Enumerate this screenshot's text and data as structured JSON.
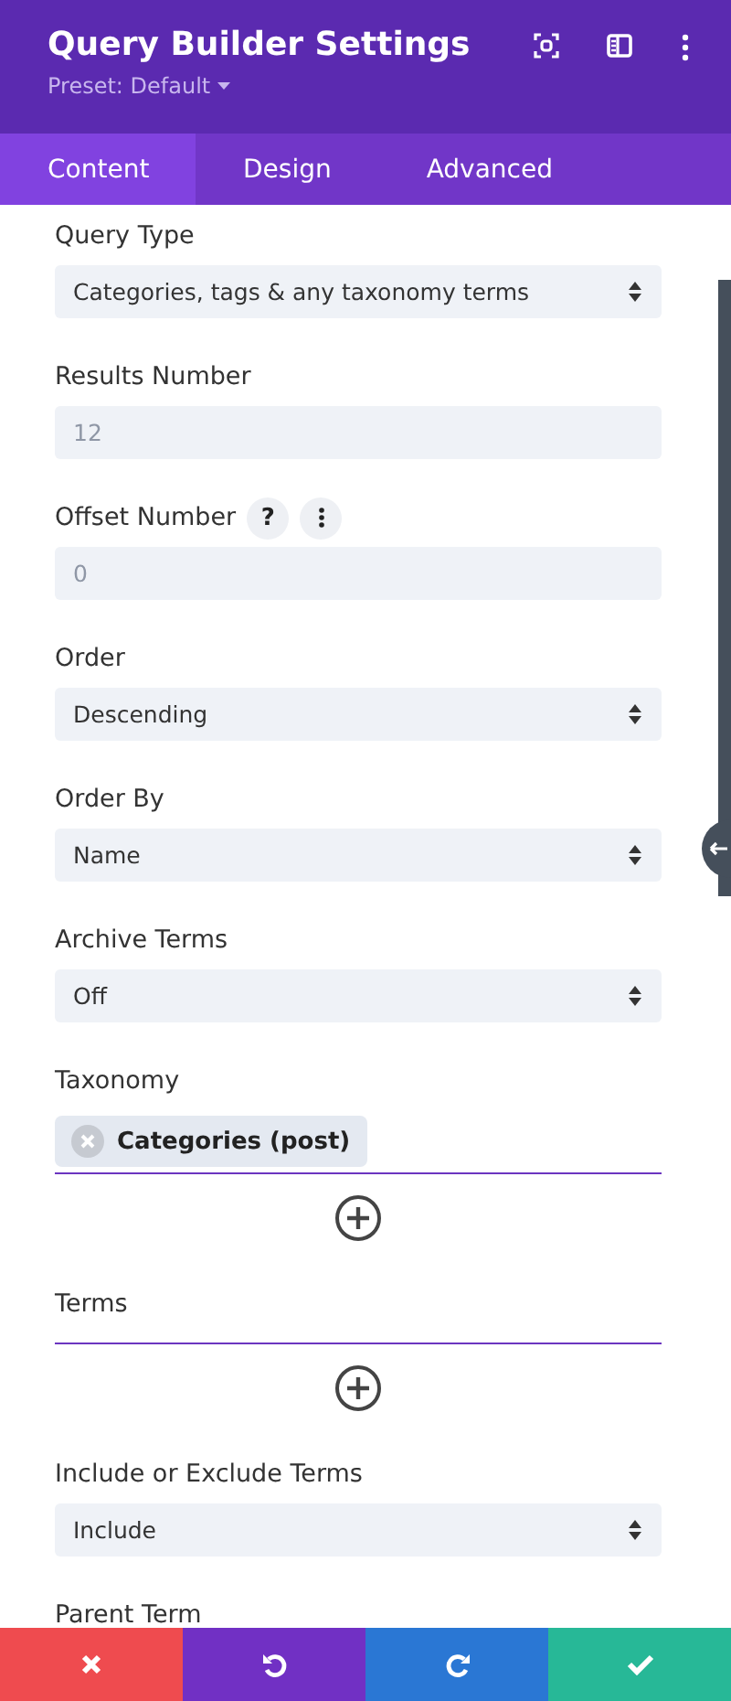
{
  "header": {
    "title": "Query Builder Settings",
    "preset": "Preset: Default"
  },
  "tabs": [
    {
      "label": "Content",
      "selected": true
    },
    {
      "label": "Design",
      "selected": false
    },
    {
      "label": "Advanced",
      "selected": false
    }
  ],
  "fields": [
    {
      "kind": "select",
      "label": "Query Type",
      "value": "Categories, tags & any taxonomy terms"
    },
    {
      "kind": "input",
      "label": "Results Number",
      "placeholder": "12"
    },
    {
      "kind": "input",
      "label": "Offset Number",
      "placeholder": "0",
      "help": "?"
    },
    {
      "kind": "select",
      "label": "Order",
      "value": "Descending"
    },
    {
      "kind": "select",
      "label": "Order By",
      "value": "Name"
    },
    {
      "kind": "select",
      "label": "Archive Terms",
      "value": "Off"
    },
    {
      "kind": "chips",
      "label": "Taxonomy",
      "chips": [
        "Categories (post)"
      ]
    },
    {
      "kind": "chips",
      "label": "Terms"
    },
    {
      "kind": "select",
      "label": "Include or Exclude Terms",
      "value": "Include"
    },
    {
      "kind": "label",
      "label": "Parent Term"
    }
  ]
}
